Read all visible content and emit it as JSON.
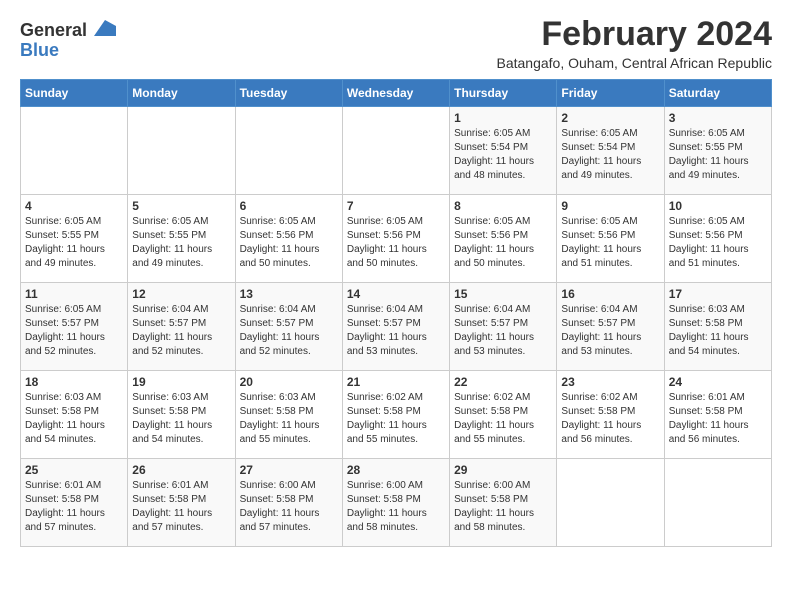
{
  "logo": {
    "general": "General",
    "blue": "Blue"
  },
  "title": "February 2024",
  "subtitle": "Batangafo, Ouham, Central African Republic",
  "weekdays": [
    "Sunday",
    "Monday",
    "Tuesday",
    "Wednesday",
    "Thursday",
    "Friday",
    "Saturday"
  ],
  "weeks": [
    [
      {
        "day": "",
        "info": ""
      },
      {
        "day": "",
        "info": ""
      },
      {
        "day": "",
        "info": ""
      },
      {
        "day": "",
        "info": ""
      },
      {
        "day": "1",
        "info": "Sunrise: 6:05 AM\nSunset: 5:54 PM\nDaylight: 11 hours and 48 minutes."
      },
      {
        "day": "2",
        "info": "Sunrise: 6:05 AM\nSunset: 5:54 PM\nDaylight: 11 hours and 49 minutes."
      },
      {
        "day": "3",
        "info": "Sunrise: 6:05 AM\nSunset: 5:55 PM\nDaylight: 11 hours and 49 minutes."
      }
    ],
    [
      {
        "day": "4",
        "info": "Sunrise: 6:05 AM\nSunset: 5:55 PM\nDaylight: 11 hours and 49 minutes."
      },
      {
        "day": "5",
        "info": "Sunrise: 6:05 AM\nSunset: 5:55 PM\nDaylight: 11 hours and 49 minutes."
      },
      {
        "day": "6",
        "info": "Sunrise: 6:05 AM\nSunset: 5:56 PM\nDaylight: 11 hours and 50 minutes."
      },
      {
        "day": "7",
        "info": "Sunrise: 6:05 AM\nSunset: 5:56 PM\nDaylight: 11 hours and 50 minutes."
      },
      {
        "day": "8",
        "info": "Sunrise: 6:05 AM\nSunset: 5:56 PM\nDaylight: 11 hours and 50 minutes."
      },
      {
        "day": "9",
        "info": "Sunrise: 6:05 AM\nSunset: 5:56 PM\nDaylight: 11 hours and 51 minutes."
      },
      {
        "day": "10",
        "info": "Sunrise: 6:05 AM\nSunset: 5:56 PM\nDaylight: 11 hours and 51 minutes."
      }
    ],
    [
      {
        "day": "11",
        "info": "Sunrise: 6:05 AM\nSunset: 5:57 PM\nDaylight: 11 hours and 52 minutes."
      },
      {
        "day": "12",
        "info": "Sunrise: 6:04 AM\nSunset: 5:57 PM\nDaylight: 11 hours and 52 minutes."
      },
      {
        "day": "13",
        "info": "Sunrise: 6:04 AM\nSunset: 5:57 PM\nDaylight: 11 hours and 52 minutes."
      },
      {
        "day": "14",
        "info": "Sunrise: 6:04 AM\nSunset: 5:57 PM\nDaylight: 11 hours and 53 minutes."
      },
      {
        "day": "15",
        "info": "Sunrise: 6:04 AM\nSunset: 5:57 PM\nDaylight: 11 hours and 53 minutes."
      },
      {
        "day": "16",
        "info": "Sunrise: 6:04 AM\nSunset: 5:57 PM\nDaylight: 11 hours and 53 minutes."
      },
      {
        "day": "17",
        "info": "Sunrise: 6:03 AM\nSunset: 5:58 PM\nDaylight: 11 hours and 54 minutes."
      }
    ],
    [
      {
        "day": "18",
        "info": "Sunrise: 6:03 AM\nSunset: 5:58 PM\nDaylight: 11 hours and 54 minutes."
      },
      {
        "day": "19",
        "info": "Sunrise: 6:03 AM\nSunset: 5:58 PM\nDaylight: 11 hours and 54 minutes."
      },
      {
        "day": "20",
        "info": "Sunrise: 6:03 AM\nSunset: 5:58 PM\nDaylight: 11 hours and 55 minutes."
      },
      {
        "day": "21",
        "info": "Sunrise: 6:02 AM\nSunset: 5:58 PM\nDaylight: 11 hours and 55 minutes."
      },
      {
        "day": "22",
        "info": "Sunrise: 6:02 AM\nSunset: 5:58 PM\nDaylight: 11 hours and 55 minutes."
      },
      {
        "day": "23",
        "info": "Sunrise: 6:02 AM\nSunset: 5:58 PM\nDaylight: 11 hours and 56 minutes."
      },
      {
        "day": "24",
        "info": "Sunrise: 6:01 AM\nSunset: 5:58 PM\nDaylight: 11 hours and 56 minutes."
      }
    ],
    [
      {
        "day": "25",
        "info": "Sunrise: 6:01 AM\nSunset: 5:58 PM\nDaylight: 11 hours and 57 minutes."
      },
      {
        "day": "26",
        "info": "Sunrise: 6:01 AM\nSunset: 5:58 PM\nDaylight: 11 hours and 57 minutes."
      },
      {
        "day": "27",
        "info": "Sunrise: 6:00 AM\nSunset: 5:58 PM\nDaylight: 11 hours and 57 minutes."
      },
      {
        "day": "28",
        "info": "Sunrise: 6:00 AM\nSunset: 5:58 PM\nDaylight: 11 hours and 58 minutes."
      },
      {
        "day": "29",
        "info": "Sunrise: 6:00 AM\nSunset: 5:58 PM\nDaylight: 11 hours and 58 minutes."
      },
      {
        "day": "",
        "info": ""
      },
      {
        "day": "",
        "info": ""
      }
    ]
  ]
}
